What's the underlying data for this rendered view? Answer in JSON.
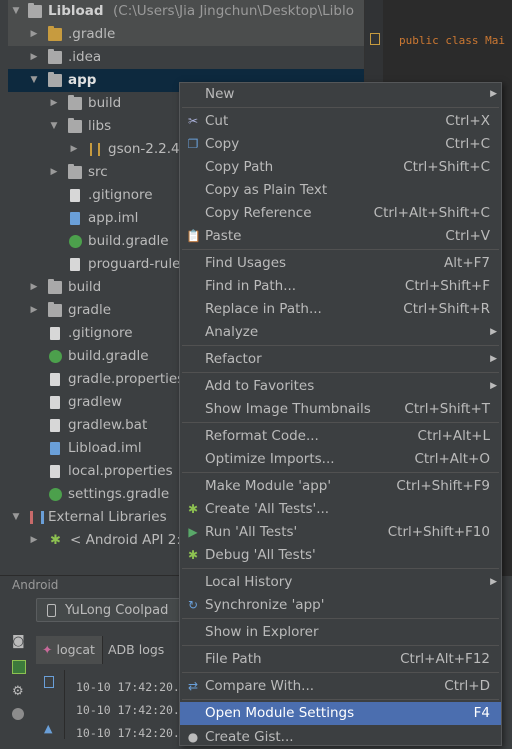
{
  "project_tree": {
    "root_label": "Libload",
    "root_path": "(C:\\Users\\Jia Jingchun\\Desktop\\Liblo",
    "items": [
      {
        "label": "Libload"
      },
      {
        "label": ".gradle"
      },
      {
        "label": ".idea"
      },
      {
        "label": "app"
      },
      {
        "label": "build"
      },
      {
        "label": "libs"
      },
      {
        "label": "gson-2.2.4."
      },
      {
        "label": "src"
      },
      {
        "label": ".gitignore"
      },
      {
        "label": "app.iml"
      },
      {
        "label": "build.gradle"
      },
      {
        "label": "proguard-rule"
      },
      {
        "label": "build"
      },
      {
        "label": "gradle"
      },
      {
        "label": ".gitignore"
      },
      {
        "label": "build.gradle"
      },
      {
        "label": "gradle.properties"
      },
      {
        "label": "gradlew"
      },
      {
        "label": "gradlew.bat"
      },
      {
        "label": "Libload.iml"
      },
      {
        "label": "local.properties"
      },
      {
        "label": "settings.gradle"
      },
      {
        "label": "External Libraries"
      },
      {
        "label": "< Android API 2:"
      }
    ]
  },
  "editor": {
    "code_line": "public class Mai"
  },
  "bottom_panel": {
    "title": "Android",
    "device": "YuLong Coolpad",
    "tabs": [
      "logcat",
      "ADB logs"
    ],
    "log_lines": [
      "10-10 17:42:20.",
      "10-10 17:42:20.",
      "10-10 17:42:20."
    ]
  },
  "context_menu": {
    "items": [
      {
        "label": "New",
        "shortcut": "",
        "submenu": true
      },
      {
        "label": "Cut",
        "shortcut": "Ctrl+X"
      },
      {
        "label": "Copy",
        "shortcut": "Ctrl+C"
      },
      {
        "label": "Copy Path",
        "shortcut": "Ctrl+Shift+C"
      },
      {
        "label": "Copy as Plain Text",
        "shortcut": ""
      },
      {
        "label": "Copy Reference",
        "shortcut": "Ctrl+Alt+Shift+C"
      },
      {
        "label": "Paste",
        "shortcut": "Ctrl+V"
      },
      {
        "label": "Find Usages",
        "shortcut": "Alt+F7"
      },
      {
        "label": "Find in Path...",
        "shortcut": "Ctrl+Shift+F"
      },
      {
        "label": "Replace in Path...",
        "shortcut": "Ctrl+Shift+R"
      },
      {
        "label": "Analyze",
        "shortcut": "",
        "submenu": true
      },
      {
        "label": "Refactor",
        "shortcut": "",
        "submenu": true
      },
      {
        "label": "Add to Favorites",
        "shortcut": "",
        "submenu": true
      },
      {
        "label": "Show Image Thumbnails",
        "shortcut": "Ctrl+Shift+T"
      },
      {
        "label": "Reformat Code...",
        "shortcut": "Ctrl+Alt+L"
      },
      {
        "label": "Optimize Imports...",
        "shortcut": "Ctrl+Alt+O"
      },
      {
        "label": "Make Module 'app'",
        "shortcut": "Ctrl+Shift+F9"
      },
      {
        "label": "Create 'All Tests'...",
        "shortcut": ""
      },
      {
        "label": "Run 'All Tests'",
        "shortcut": "Ctrl+Shift+F10"
      },
      {
        "label": "Debug 'All Tests'",
        "shortcut": ""
      },
      {
        "label": "Local History",
        "shortcut": "",
        "submenu": true
      },
      {
        "label": "Synchronize 'app'",
        "shortcut": ""
      },
      {
        "label": "Show in Explorer",
        "shortcut": ""
      },
      {
        "label": "File Path",
        "shortcut": "Ctrl+Alt+F12"
      },
      {
        "label": "Compare With...",
        "shortcut": "Ctrl+D"
      },
      {
        "label": "Open Module Settings",
        "shortcut": "F4"
      },
      {
        "label": "Create Gist...",
        "shortcut": ""
      }
    ]
  },
  "colors": {
    "background": "#3c3f41",
    "highlight": "#4b6eaf",
    "selection": "#0d293e"
  }
}
